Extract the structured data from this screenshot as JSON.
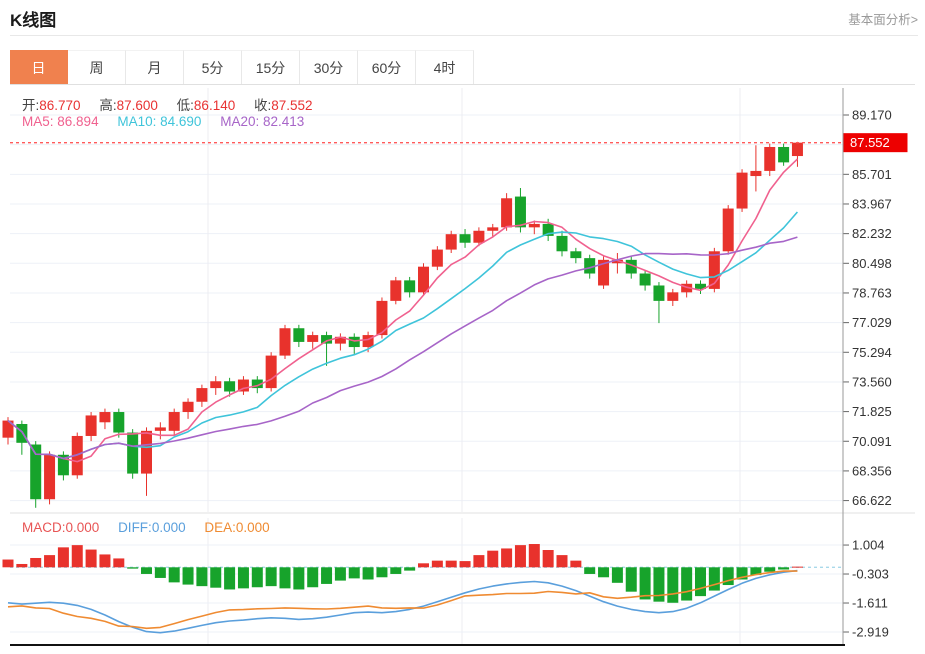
{
  "header": {
    "title": "K线图",
    "link": "基本面分析>"
  },
  "tabs": [
    {
      "label": "日",
      "active": true
    },
    {
      "label": "周",
      "active": false
    },
    {
      "label": "月",
      "active": false
    },
    {
      "label": "5分",
      "active": false
    },
    {
      "label": "15分",
      "active": false
    },
    {
      "label": "30分",
      "active": false
    },
    {
      "label": "60分",
      "active": false
    },
    {
      "label": "4时",
      "active": false
    }
  ],
  "info": {
    "ohlc": [
      {
        "label": "开:",
        "value": "86.770"
      },
      {
        "label": "高:",
        "value": "87.600"
      },
      {
        "label": "低:",
        "value": "86.140"
      },
      {
        "label": "收:",
        "value": "87.552"
      }
    ],
    "ohlc_value_color": "#e83232",
    "ma": [
      {
        "label": "MA5:",
        "value": "86.894",
        "color": "#f0618f"
      },
      {
        "label": "MA10:",
        "value": "84.690",
        "color": "#3fc4da"
      },
      {
        "label": "MA20:",
        "value": "82.413",
        "color": "#a765c8"
      }
    ]
  },
  "macd_info": [
    {
      "label": "MACD:",
      "value": "0.000",
      "color": "#e85555"
    },
    {
      "label": "DIFF:",
      "value": "0.000",
      "color": "#5a9fdc"
    },
    {
      "label": "DEA:",
      "value": "0.000",
      "color": "#ef8b32"
    }
  ],
  "chart_data": {
    "type": "candlestick",
    "title": "K线图 日K",
    "main": {
      "y_ticks": [
        89.17,
        85.701,
        83.967,
        82.232,
        80.498,
        78.763,
        77.029,
        75.294,
        73.56,
        71.825,
        70.091,
        68.356,
        66.622
      ],
      "tick_step": 1.7345,
      "y_top": 89.17,
      "last_price": 87.552,
      "last_price_label": "87.552",
      "up_color": "#e8322c",
      "down_color": "#17a32b",
      "ma_lines": [
        {
          "window": 5,
          "color": "#f0618f"
        },
        {
          "window": 10,
          "color": "#3fc4da"
        },
        {
          "window": 20,
          "color": "#a765c8"
        }
      ],
      "candles": [
        [
          70.3,
          71.5,
          69.9,
          71.3
        ],
        [
          71.1,
          71.3,
          69.3,
          70.0
        ],
        [
          69.9,
          70.1,
          66.2,
          66.7
        ],
        [
          66.7,
          69.5,
          66.4,
          69.3
        ],
        [
          69.3,
          69.5,
          67.8,
          68.1
        ],
        [
          68.1,
          70.6,
          67.9,
          70.4
        ],
        [
          70.4,
          71.8,
          70.1,
          71.6
        ],
        [
          71.2,
          72.0,
          70.8,
          71.8
        ],
        [
          71.8,
          72.0,
          70.3,
          70.6
        ],
        [
          70.6,
          70.8,
          67.9,
          68.2
        ],
        [
          68.2,
          70.9,
          66.9,
          70.7
        ],
        [
          70.7,
          71.2,
          70.2,
          70.9
        ],
        [
          70.7,
          72.0,
          70.4,
          71.8
        ],
        [
          71.8,
          72.6,
          71.4,
          72.4
        ],
        [
          72.4,
          73.4,
          72.1,
          73.2
        ],
        [
          73.2,
          73.9,
          72.8,
          73.6
        ],
        [
          73.6,
          73.8,
          72.7,
          73.0
        ],
        [
          73.0,
          73.9,
          72.8,
          73.7
        ],
        [
          73.7,
          73.9,
          72.9,
          73.2
        ],
        [
          73.2,
          75.3,
          73.0,
          75.1
        ],
        [
          75.1,
          76.9,
          74.9,
          76.7
        ],
        [
          76.7,
          76.9,
          75.6,
          75.9
        ],
        [
          75.9,
          76.5,
          75.5,
          76.3
        ],
        [
          76.3,
          76.5,
          74.5,
          75.8
        ],
        [
          75.8,
          76.4,
          75.4,
          76.2
        ],
        [
          76.2,
          76.4,
          75.2,
          75.6
        ],
        [
          75.6,
          76.5,
          75.3,
          76.3
        ],
        [
          76.3,
          78.5,
          76.1,
          78.3
        ],
        [
          78.3,
          79.7,
          78.1,
          79.5
        ],
        [
          79.5,
          79.7,
          78.5,
          78.8
        ],
        [
          78.8,
          80.5,
          78.6,
          80.3
        ],
        [
          80.3,
          81.5,
          80.1,
          81.3
        ],
        [
          81.3,
          82.4,
          81.1,
          82.2
        ],
        [
          82.2,
          82.5,
          81.4,
          81.7
        ],
        [
          81.7,
          82.6,
          81.5,
          82.4
        ],
        [
          82.4,
          82.8,
          82.0,
          82.6
        ],
        [
          82.6,
          84.6,
          82.4,
          84.3
        ],
        [
          84.4,
          84.9,
          82.3,
          82.6
        ],
        [
          82.6,
          83.0,
          82.2,
          82.8
        ],
        [
          82.8,
          83.1,
          81.8,
          82.1
        ],
        [
          82.1,
          82.4,
          80.9,
          81.2
        ],
        [
          81.2,
          81.4,
          80.5,
          80.8
        ],
        [
          80.8,
          81.0,
          79.6,
          79.9
        ],
        [
          79.2,
          80.9,
          79.0,
          80.7
        ],
        [
          80.5,
          81.1,
          79.9,
          80.7
        ],
        [
          80.7,
          80.9,
          79.6,
          79.9
        ],
        [
          79.9,
          80.1,
          78.9,
          79.2
        ],
        [
          79.2,
          79.4,
          77.0,
          78.3
        ],
        [
          78.3,
          79.0,
          78.0,
          78.8
        ],
        [
          78.8,
          79.5,
          78.5,
          79.3
        ],
        [
          79.3,
          79.5,
          78.7,
          79.0
        ],
        [
          79.0,
          81.4,
          78.8,
          81.2
        ],
        [
          81.2,
          83.9,
          81.0,
          83.7
        ],
        [
          83.7,
          86.0,
          83.5,
          85.8
        ],
        [
          85.6,
          87.4,
          84.7,
          85.9
        ],
        [
          85.9,
          87.5,
          85.6,
          87.3
        ],
        [
          87.3,
          87.5,
          86.2,
          86.4
        ],
        [
          86.77,
          87.6,
          86.14,
          87.552
        ]
      ]
    },
    "macd": {
      "y_ticks": [
        1.004,
        -0.303,
        -1.611,
        -2.919
      ],
      "macd_value": 0.0,
      "diff_value": 0.0,
      "dea_value": 0.0,
      "hist_up_color": "#e8322c",
      "hist_down_color": "#17a32b",
      "diff_color": "#5a9fdc",
      "dea_color": "#ef8b32",
      "histogram": [
        0.35,
        0.15,
        0.42,
        0.55,
        0.9,
        1.0,
        0.8,
        0.58,
        0.4,
        -0.06,
        -0.3,
        -0.48,
        -0.68,
        -0.78,
        -0.85,
        -0.92,
        -1.0,
        -0.95,
        -0.9,
        -0.85,
        -0.95,
        -1.0,
        -0.9,
        -0.75,
        -0.6,
        -0.5,
        -0.55,
        -0.45,
        -0.3,
        -0.15,
        0.18,
        0.3,
        0.3,
        0.28,
        0.55,
        0.75,
        0.85,
        1.0,
        1.05,
        0.78,
        0.55,
        0.3,
        -0.3,
        -0.45,
        -0.7,
        -1.1,
        -1.45,
        -1.55,
        -1.6,
        -1.5,
        -1.3,
        -1.05,
        -0.8,
        -0.55,
        -0.35,
        -0.2,
        -0.1,
        0.03
      ],
      "diff": [
        -1.6,
        -1.66,
        -1.62,
        -1.58,
        -1.62,
        -1.72,
        -1.9,
        -2.15,
        -2.45,
        -2.7,
        -2.9,
        -2.95,
        -2.88,
        -2.75,
        -2.62,
        -2.5,
        -2.42,
        -2.38,
        -2.32,
        -2.28,
        -2.3,
        -2.35,
        -2.32,
        -2.25,
        -2.15,
        -2.05,
        -2.02,
        -2.05,
        -2.0,
        -1.9,
        -1.75,
        -1.55,
        -1.35,
        -1.15,
        -0.98,
        -0.85,
        -0.75,
        -0.68,
        -0.64,
        -0.7,
        -0.85,
        -1.05,
        -1.3,
        -1.55,
        -1.75,
        -1.9,
        -2.0,
        -2.05,
        -2.0,
        -1.85,
        -1.6,
        -1.3,
        -1.0,
        -0.72,
        -0.5,
        -0.34,
        -0.22,
        -0.15
      ],
      "dea": [
        -1.78,
        -1.74,
        -1.83,
        -1.86,
        -2.07,
        -2.22,
        -2.3,
        -2.44,
        -2.65,
        -2.67,
        -2.75,
        -2.71,
        -2.54,
        -2.36,
        -2.2,
        -2.04,
        -1.92,
        -1.91,
        -1.87,
        -1.86,
        -1.83,
        -1.85,
        -1.87,
        -1.88,
        -1.85,
        -1.8,
        -1.75,
        -1.83,
        -1.85,
        -1.83,
        -1.84,
        -1.7,
        -1.5,
        -1.29,
        -1.26,
        -1.23,
        -1.18,
        -1.18,
        -1.17,
        -1.09,
        -1.13,
        -1.2,
        -1.15,
        -1.33,
        -1.4,
        -1.35,
        -1.28,
        -1.27,
        -1.2,
        -1.1,
        -0.95,
        -0.78,
        -0.6,
        -0.45,
        -0.33,
        -0.24,
        -0.17,
        -0.17
      ]
    },
    "style": {
      "grid_color": "#edf1f7",
      "vgrid_color": "#ececf2",
      "dashed_last_price_color": "#ff5a5a",
      "price_tag_bg": "#ed0000",
      "macd_zero_line_color": "#a9d9ea",
      "axis_text_color": "#333333"
    }
  }
}
